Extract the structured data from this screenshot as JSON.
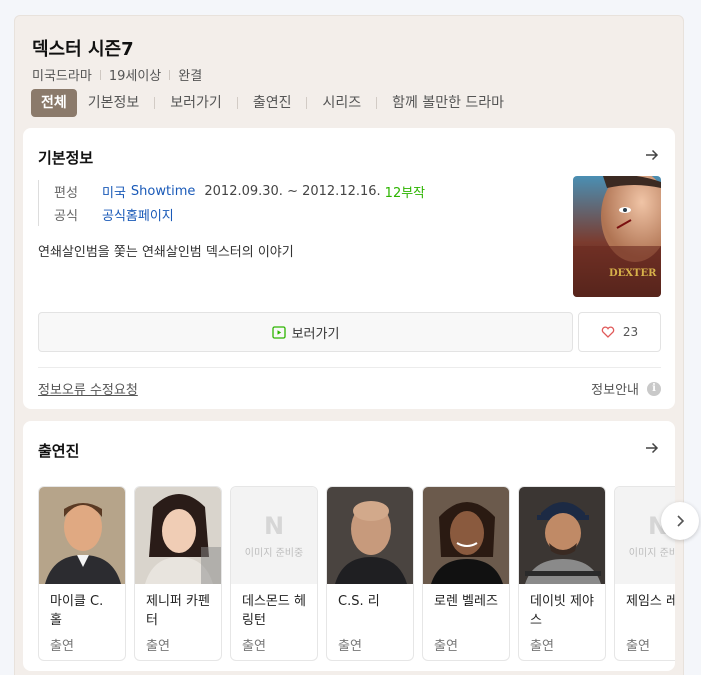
{
  "header": {
    "title": "덱스터 시즌7",
    "meta": [
      "미국드라마",
      "19세이상",
      "완결"
    ],
    "tabs": [
      "전체",
      "기본정보",
      "보러가기",
      "출연진",
      "시리즈",
      "함께 볼만한 드라마"
    ]
  },
  "info": {
    "heading": "기본정보",
    "broadcast_label": "편성",
    "broadcast_country": "미국",
    "broadcast_channel": "Showtime",
    "broadcast_dates": "2012.09.30. ~ 2012.12.16.",
    "broadcast_episodes": "12부작",
    "official_label": "공식",
    "official_link": "공식홈페이지",
    "description": "연쇄살인범을 쫓는 연쇄살인범 덱스터의 이야기",
    "poster_text": "DEXTER",
    "watch_label": "보러가기",
    "like_count": "23",
    "report_label": "정보오류 수정요청",
    "guide_label": "정보안내",
    "guide_icon": "i"
  },
  "cast": {
    "heading": "출연진",
    "noimage_logo": "N",
    "noimage_text": "이미지 준비중",
    "members": [
      {
        "name": "마이클 C. 홀",
        "role": "출연",
        "photo": "photo"
      },
      {
        "name": "제니퍼 카펜터",
        "role": "출연",
        "photo": "photo"
      },
      {
        "name": "데스몬드 헤링턴",
        "role": "출연",
        "photo": "none"
      },
      {
        "name": "C.S. 리",
        "role": "출연",
        "photo": "photo"
      },
      {
        "name": "로렌 벨레즈",
        "role": "출연",
        "photo": "photo"
      },
      {
        "name": "데이빗 제야스",
        "role": "출연",
        "photo": "photo"
      },
      {
        "name": "제임스 레마",
        "role": "출연",
        "photo": "none"
      }
    ]
  },
  "colors": {
    "accent": "#8b7a6b",
    "link": "#1a5ab8",
    "episodes": "#2db400",
    "background": "#f3eeea"
  },
  "icons": [
    "arrow-right-icon",
    "play-screen-icon",
    "heart-icon",
    "info-icon",
    "chevron-right-icon",
    "naver-n-icon"
  ]
}
